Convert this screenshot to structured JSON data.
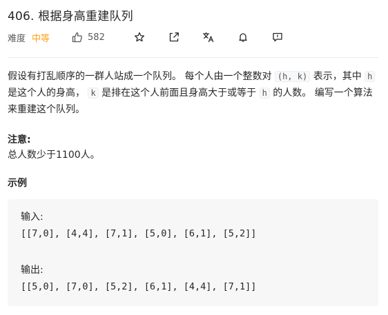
{
  "problem": {
    "title": "406. 根据身高重建队列",
    "difficulty_label": "难度",
    "difficulty": "中等",
    "likes": "582"
  },
  "toolbar": {
    "icons": [
      "thumbs-up-icon",
      "star-icon",
      "share-icon",
      "translate-icon",
      "bell-icon",
      "feedback-icon"
    ]
  },
  "description": {
    "p1": "假设有打乱顺序的一群人站成一个队列。 每个人由一个整数对",
    "code1": "(h, k)",
    "p2": "表示，其中",
    "code2": "h",
    "p3": "是这个人的身高，",
    "code3": "k",
    "p4": "是排在这个人前面且身高大于或等于",
    "code4": "h",
    "p5": "的人数。 编写一个算法来重建这个队列。"
  },
  "note": {
    "heading": "注意:",
    "text": "总人数少于1100人。"
  },
  "example": {
    "heading": "示例",
    "input_label": "输入:",
    "input": "[[7,0], [4,4], [7,1], [5,0], [6,1], [5,2]]",
    "output_label": "输出:",
    "output": "[[5,0], [7,0], [5,2], [6,1], [4,4], [7,1]]"
  },
  "colors": {
    "difficulty_medium": "#ffa116",
    "text": "#262626",
    "muted": "#595959",
    "code_bg": "#f7f7f7"
  }
}
